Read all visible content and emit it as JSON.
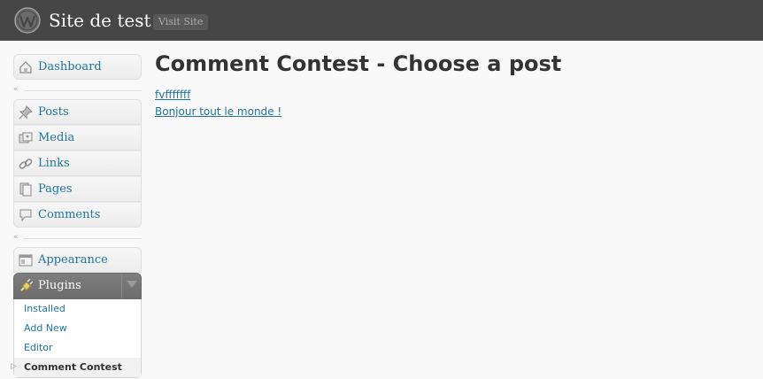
{
  "header": {
    "site_title": "Site de test",
    "visit_site_label": "Visit Site",
    "background": "#464646"
  },
  "menu": {
    "dashboard": {
      "label": "Dashboard",
      "icon": "dashboard-icon"
    },
    "items": [
      {
        "label": "Posts",
        "icon": "pushpin-icon"
      },
      {
        "label": "Media",
        "icon": "media-icon"
      },
      {
        "label": "Links",
        "icon": "link-icon"
      },
      {
        "label": "Pages",
        "icon": "pages-icon"
      },
      {
        "label": "Comments",
        "icon": "comment-icon"
      }
    ],
    "appearance": {
      "label": "Appearance",
      "icon": "appearance-icon"
    },
    "plugins": {
      "label": "Plugins",
      "icon": "plug-icon",
      "submenu": [
        "Installed",
        "Add New",
        "Editor",
        "Comment Contest"
      ],
      "current": "Comment Contest"
    }
  },
  "main": {
    "title": "Comment Contest - Choose a post",
    "posts": [
      "fvfffffff",
      "Bonjour tout le monde !"
    ]
  },
  "colors": {
    "link": "#21759b",
    "text": "#333333",
    "menu_active": "#6d6d6d"
  }
}
